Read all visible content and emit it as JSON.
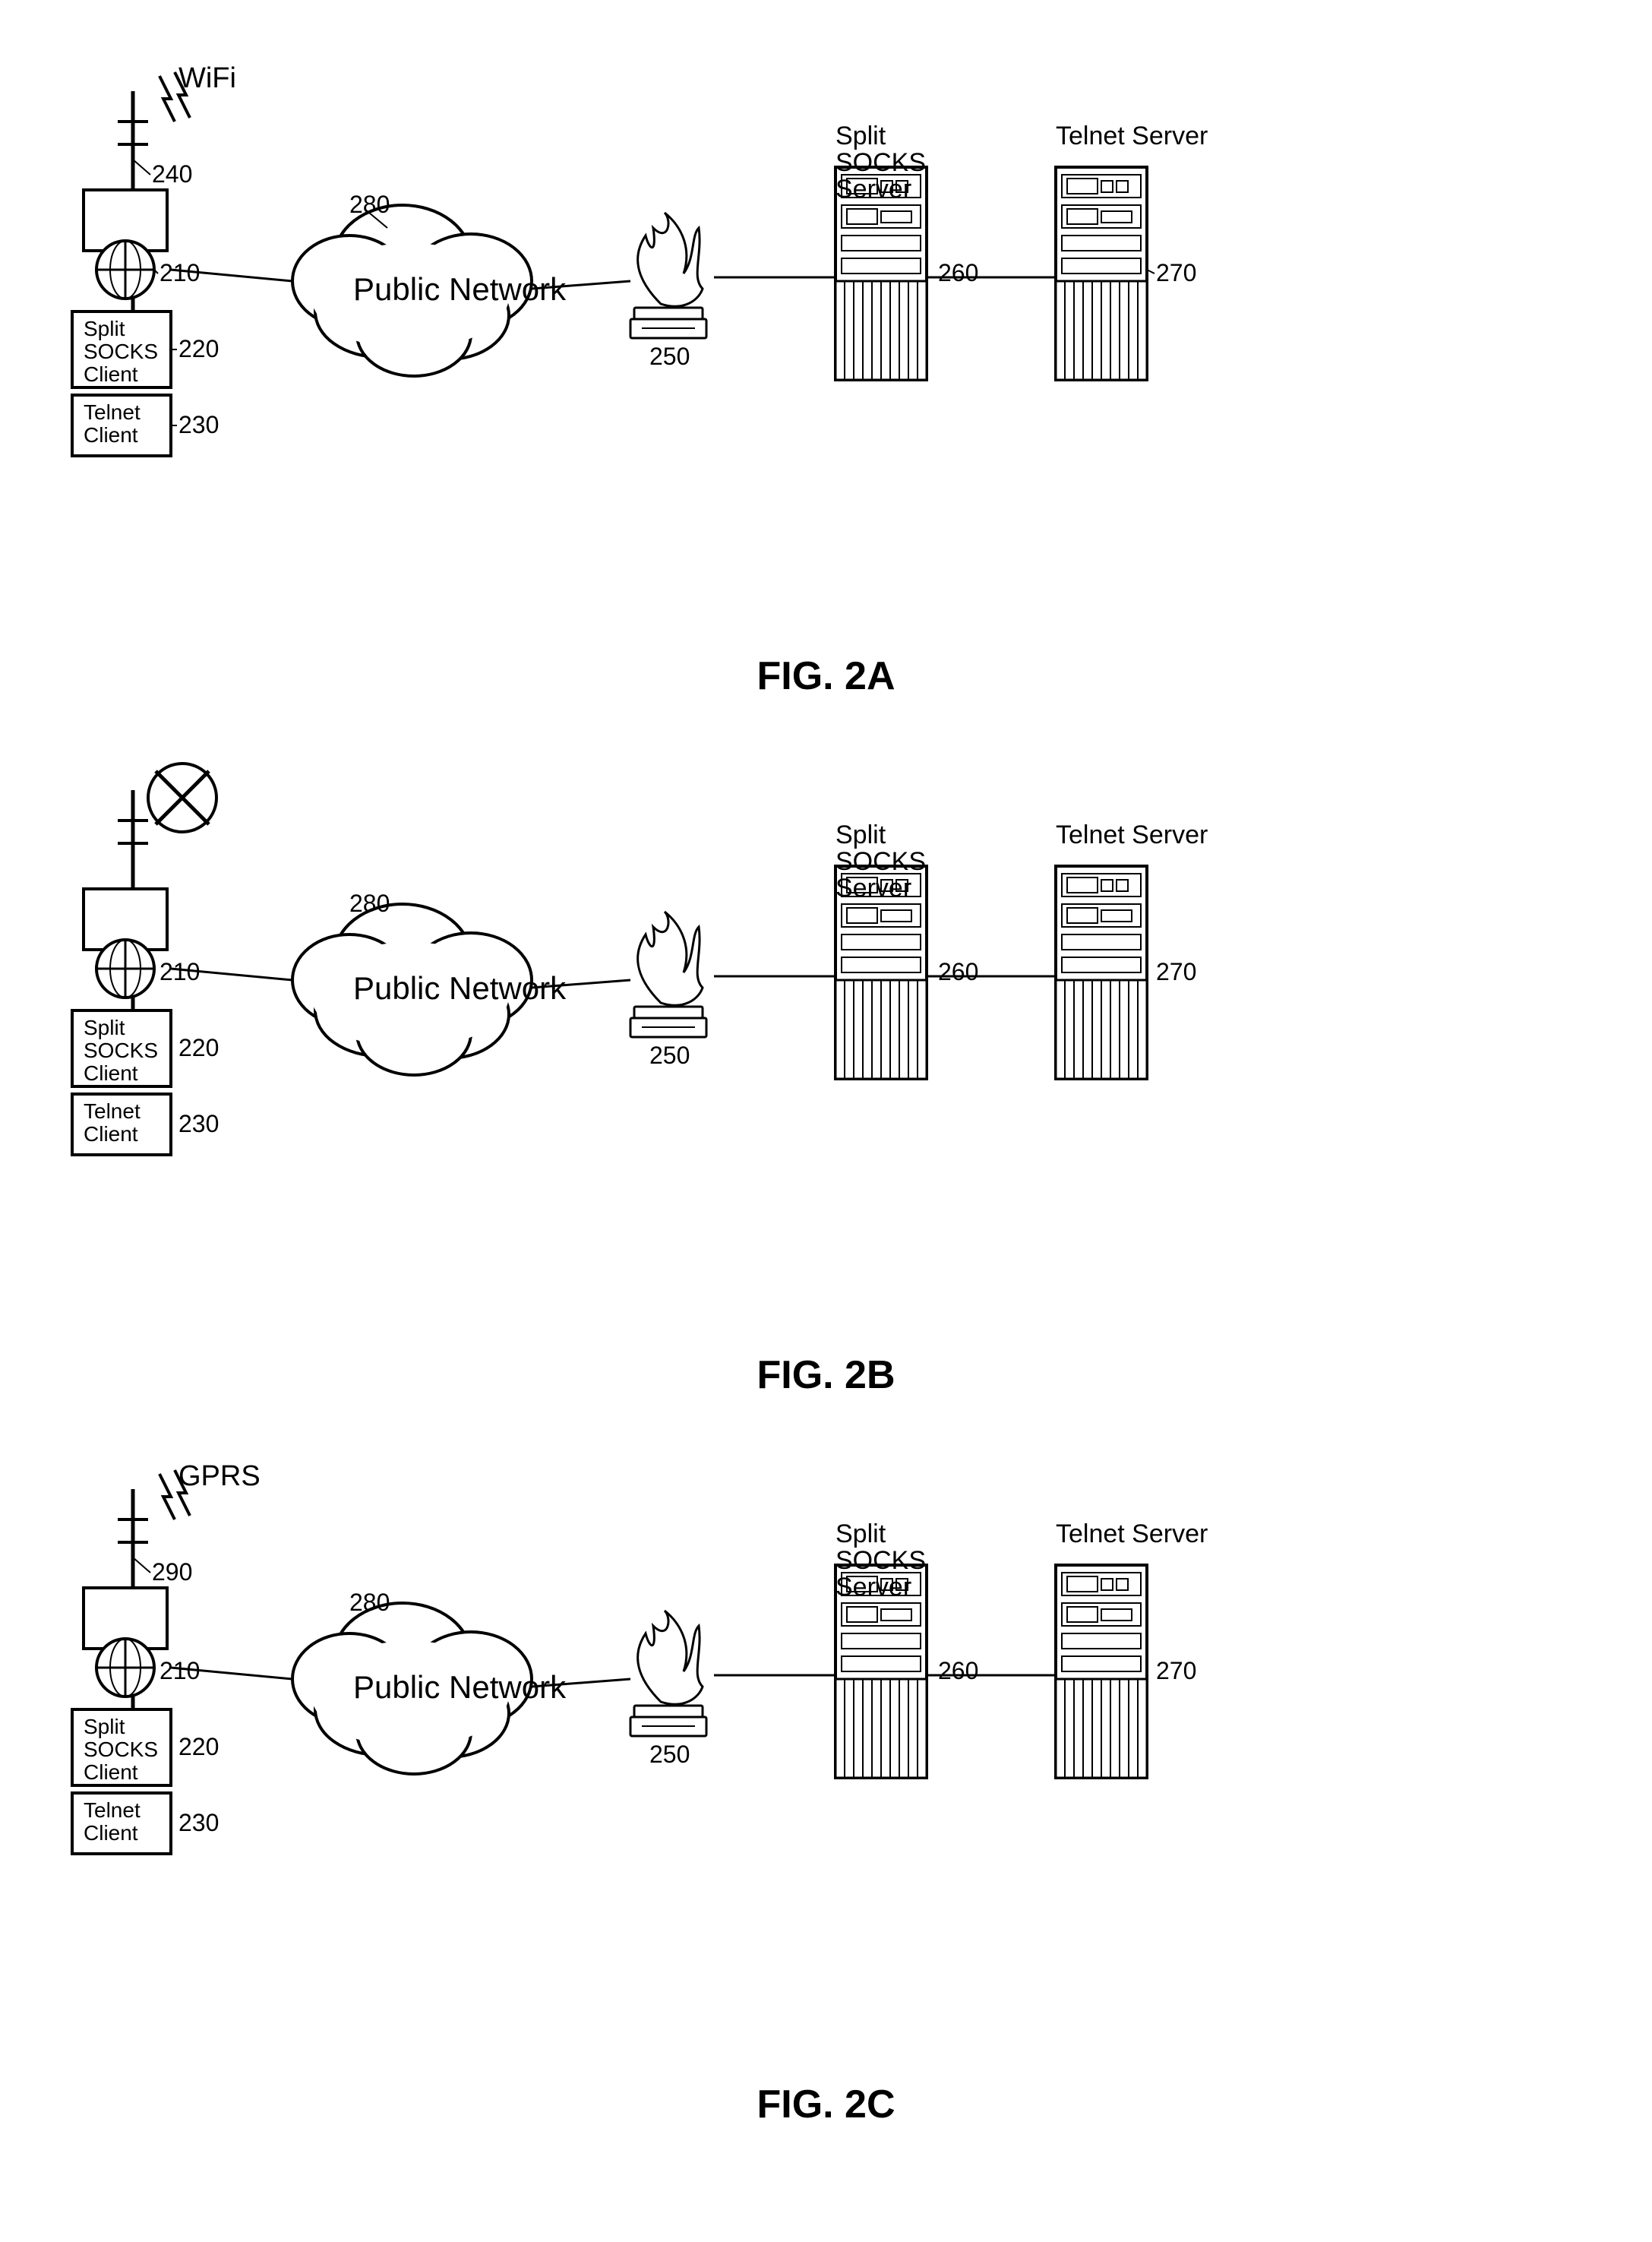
{
  "diagrams": [
    {
      "id": "fig2a",
      "label": "FIG. 2A",
      "wifi_label": "WiFi",
      "network_label": "Public Network",
      "network_ref": "280",
      "mobile_ref": "240",
      "phone_ref": "210",
      "split_socks_client_label": "Split\nSOCKS\nClient",
      "split_socks_client_ref": "220",
      "telnet_client_label": "Telnet\nClient",
      "telnet_client_ref": "230",
      "firewall_ref": "250",
      "split_socks_server_label": "Split\nSOCKS\nServer",
      "split_socks_server_ref": "260",
      "telnet_server_label": "Telnet Server",
      "telnet_server_ref": "270",
      "has_wifi": true,
      "has_gprs": false,
      "wifi_active": true
    },
    {
      "id": "fig2b",
      "label": "FIG. 2B",
      "wifi_label": "",
      "network_label": "Public Network",
      "network_ref": "280",
      "mobile_ref": "",
      "phone_ref": "210",
      "split_socks_client_label": "Split\nSOCKS\nClient",
      "split_socks_client_ref": "220",
      "telnet_client_label": "Telnet\nClient",
      "telnet_client_ref": "230",
      "firewall_ref": "250",
      "split_socks_server_label": "Split\nSOCKS\nServer",
      "split_socks_server_ref": "260",
      "telnet_server_label": "Telnet Server",
      "telnet_server_ref": "270",
      "has_wifi": false,
      "has_gprs": false,
      "wifi_active": false
    },
    {
      "id": "fig2c",
      "label": "FIG. 2C",
      "wifi_label": "GPRS",
      "network_label": "Public Network",
      "network_ref": "280",
      "mobile_ref": "290",
      "phone_ref": "210",
      "split_socks_client_label": "Split\nSOCKS\nClient",
      "split_socks_client_ref": "220",
      "telnet_client_label": "Telnet\nClient",
      "telnet_client_ref": "230",
      "firewall_ref": "250",
      "split_socks_server_label": "Split\nSOCKS\nServer",
      "split_socks_server_ref": "260",
      "telnet_server_label": "Telnet Server",
      "telnet_server_ref": "270",
      "has_wifi": false,
      "has_gprs": true,
      "wifi_active": false
    }
  ]
}
